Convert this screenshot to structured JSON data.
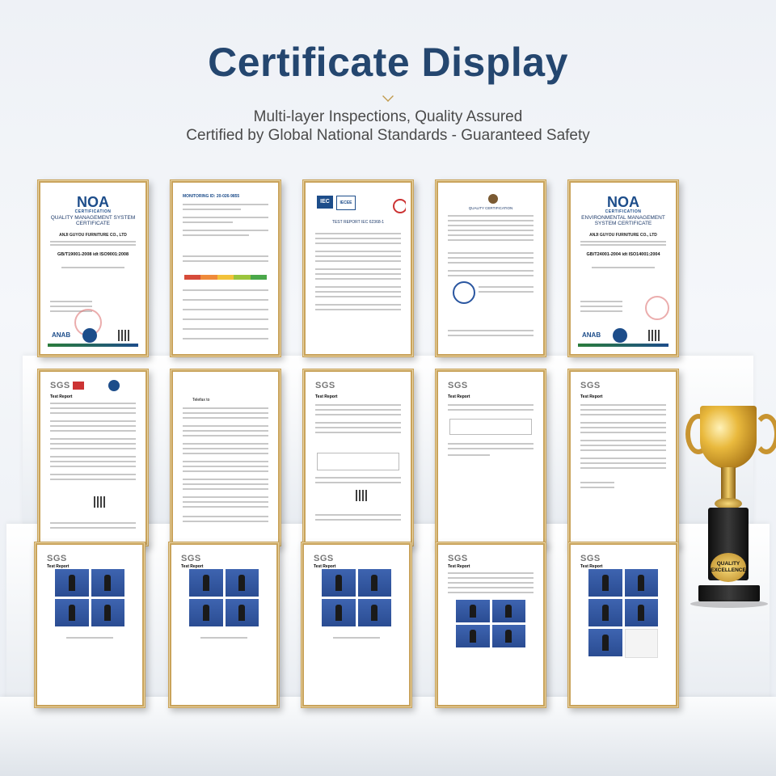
{
  "header": {
    "title": "Certificate Display",
    "subtitle_line1": "Multi-layer Inspections, Quality Assured",
    "subtitle_line2": "Certified by Global National Standards - Guaranteed Safety"
  },
  "row1": [
    {
      "logo": "NOA",
      "logo_sub": "CERTIFICATION",
      "heading": "QUALITY MANAGEMENT SYSTEM CERTIFICATE",
      "company": "ANJI GUYOU FURNITURE CO., LTD",
      "standard": "GB/T19001-2008 idt ISO9001:2008"
    },
    {
      "header": "MONITORING ID: 20-026-9855"
    },
    {
      "logos": [
        "IEC",
        "IECEE"
      ],
      "heading": "TEST REPORT IEC 62368-1"
    },
    {
      "heading": "QUALITY CERTIFICATION"
    },
    {
      "logo": "NOA",
      "logo_sub": "CERTIFICATION",
      "heading": "ENVIRONMENTAL MANAGEMENT SYSTEM CERTIFICATE",
      "company": "ANJI GUYOU FURNITURE CO., LTD",
      "standard": "GB/T24001-2004 idt ISO14001:2004"
    }
  ],
  "row2": [
    {
      "logo": "SGS",
      "title": "Test Report"
    },
    {
      "title": "Telefax to"
    },
    {
      "logo": "SGS",
      "title": "Test Report"
    },
    {
      "logo": "SGS",
      "title": "Test Report"
    },
    {
      "logo": "SGS",
      "title": "Test Report"
    }
  ],
  "row3": [
    {
      "logo": "SGS",
      "title": "Test Report"
    },
    {
      "logo": "SGS",
      "title": "Test Report"
    },
    {
      "logo": "SGS",
      "title": "Test Report"
    },
    {
      "logo": "SGS",
      "title": "Test Report"
    },
    {
      "logo": "SGS",
      "title": "Test Report"
    }
  ],
  "trophy": {
    "plate_line1": "QUALITY",
    "plate_line2": "EXCELLENCE"
  },
  "colors": {
    "title": "#24466f",
    "frame_gold": "#c9a35b",
    "noa_blue": "#1d4d8a"
  }
}
